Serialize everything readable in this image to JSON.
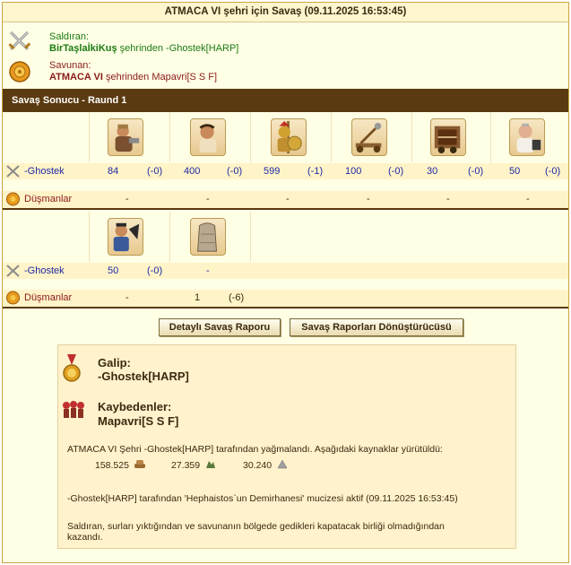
{
  "title": "ATMACA VI şehri için Savaş (09.11.2025 16:53:45)",
  "attacker": {
    "label": "Saldıran:",
    "city": "BirTaşlaİkiKuş",
    "suffix": "şehrinden -Ghostek[HARP]"
  },
  "defender": {
    "label": "Savunan:",
    "city": "ATMACA VI",
    "suffix": "şehrinden Mapavri[S S F]"
  },
  "round_banner": "Savaş Sonucu - Raund 1",
  "round1": {
    "ours_name": "-Ghostek",
    "enemy_name": "Düşmanlar",
    "units": [
      {
        "icon": "hoplite-icon",
        "count": "84",
        "loss": "(-0)"
      },
      {
        "icon": "slinger-icon",
        "count": "400",
        "loss": "(-0)"
      },
      {
        "icon": "spartan-icon",
        "count": "599",
        "loss": "(-1)"
      },
      {
        "icon": "catapult-icon",
        "count": "100",
        "loss": "(-0)"
      },
      {
        "icon": "ballista-icon",
        "count": "30",
        "loss": "(-0)"
      },
      {
        "icon": "doctor-icon",
        "count": "50",
        "loss": "(-0)"
      }
    ],
    "enemy_values": [
      "-",
      "-",
      "-",
      "-",
      "-",
      "-"
    ]
  },
  "round2": {
    "ours_name": "-Ghostek",
    "enemy_name": "Düşmanlar",
    "units": [
      {
        "icon": "cook-icon",
        "count": "50",
        "loss": "(-0)"
      },
      {
        "icon": "wall-icon",
        "count": "-",
        "loss": ""
      }
    ],
    "enemy_values": [
      {
        "count": "-",
        "loss": ""
      },
      {
        "count": "1",
        "loss": "(-6)"
      }
    ]
  },
  "buttons": {
    "detail": "Detaylı Savaş Raporu",
    "converter": "Savaş Raporları Dönüştürücüsü"
  },
  "result": {
    "winner_label": "Galip:",
    "winner_name": "-Ghostek[HARP]",
    "losers_label": "Kaybedenler:",
    "losers_name": "Mapavri[S S F]",
    "plunder_text": "ATMACA VI Şehri -Ghostek[HARP] tarafından yağmalandı. Aşağıdaki kaynaklar yürütüldü:",
    "resources": [
      "158.525",
      "27.359",
      "30.240"
    ],
    "wonder_text": "-Ghostek[HARP] tarafından 'Hephaistos`un Demirhanesi' mucizesi aktif (09.11.2025 16:53:45)",
    "final_text_1": "Saldıran, surları yıktığından ve savunanın bölgede gedikleri kapatacak birliği olmadığından",
    "final_text_2": "kazandı."
  },
  "colors": {
    "banner": "#5a3a10",
    "panel": "#ffffe5",
    "attacker_text": "#1b7a12",
    "defender_text": "#8a1a1a",
    "unit_text": "#1f2aa6"
  }
}
